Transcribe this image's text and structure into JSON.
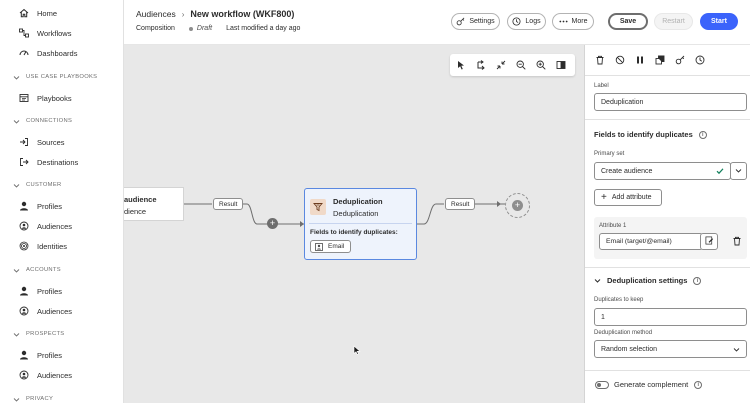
{
  "sidebar": {
    "top_items": [
      {
        "label": "Home",
        "icon": "home-icon"
      },
      {
        "label": "Workflows",
        "icon": "workflows-icon"
      },
      {
        "label": "Dashboards",
        "icon": "dashboards-icon"
      }
    ],
    "sections": [
      {
        "title": "USE CASE PLAYBOOKS",
        "items": [
          {
            "label": "Playbooks",
            "icon": "playbooks-icon"
          }
        ]
      },
      {
        "title": "CONNECTIONS",
        "items": [
          {
            "label": "Sources",
            "icon": "sources-icon"
          },
          {
            "label": "Destinations",
            "icon": "destinations-icon"
          }
        ]
      },
      {
        "title": "CUSTOMER",
        "items": [
          {
            "label": "Profiles",
            "icon": "profile-icon"
          },
          {
            "label": "Audiences",
            "icon": "audiences-icon"
          },
          {
            "label": "Identities",
            "icon": "identities-icon"
          }
        ]
      },
      {
        "title": "ACCOUNTS",
        "items": [
          {
            "label": "Profiles",
            "icon": "profile-icon"
          },
          {
            "label": "Audiences",
            "icon": "audiences-icon"
          }
        ]
      },
      {
        "title": "PROSPECTS",
        "items": [
          {
            "label": "Profiles",
            "icon": "profile-icon"
          },
          {
            "label": "Audiences",
            "icon": "audiences-icon"
          }
        ]
      },
      {
        "title": "PRIVACY",
        "items": []
      }
    ]
  },
  "header": {
    "breadcrumb_parent": "Audiences",
    "breadcrumb_sep": "›",
    "title": "New workflow (WKF800)",
    "composition": "Composition",
    "status": "Draft",
    "modified": "Last modified a day ago",
    "settings_label": "Settings",
    "logs_label": "Logs",
    "more_label": "More",
    "save_label": "Save",
    "restart_label": "Restart",
    "start_label": "Start"
  },
  "canvas": {
    "prev_node_title": "audience",
    "prev_node_sub": "dience",
    "result_label_1": "Result",
    "result_label_2": "Result",
    "node": {
      "name": "Deduplication",
      "sub": "Deduplication",
      "fields_label": "Fields to identify duplicates:",
      "chip": "Email"
    }
  },
  "panel": {
    "label_title": "Label",
    "label_value": "Deduplication",
    "fields_title": "Fields to identify duplicates",
    "primary_set_label": "Primary set",
    "primary_set_value": "Create audience",
    "add_attribute_label": "Add attribute",
    "attribute_label": "Attribute 1",
    "attribute_value": "Email (target/@email)",
    "dedup_settings_title": "Deduplication settings",
    "duplicates_label": "Duplicates to keep",
    "duplicates_value": "1",
    "method_label": "Deduplication method",
    "method_value": "Random selection",
    "complement_label": "Generate complement"
  },
  "colors": {
    "accent": "#3b63fb",
    "node_border": "#5a88e0",
    "node_bg": "#eef3fc",
    "canvas_bg": "#e8e8e8",
    "check": "#12805c"
  }
}
